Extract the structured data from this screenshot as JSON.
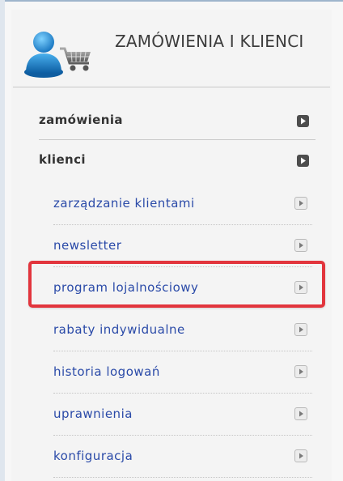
{
  "header": {
    "icon": "user-cart-icon",
    "title": "ZAMÓWIENIA I KLIENCI"
  },
  "sections": [
    {
      "label": "zamówienia",
      "icon": "square-arrow-icon"
    },
    {
      "label": "klienci",
      "icon": "square-arrow-icon"
    }
  ],
  "submenu": [
    {
      "label": "zarządzanie klientami",
      "icon": "play-arrow-icon"
    },
    {
      "label": "newsletter",
      "icon": "play-arrow-icon"
    },
    {
      "label": "program lojalnościowy",
      "icon": "play-arrow-icon"
    },
    {
      "label": "rabaty indywidualne",
      "icon": "play-arrow-icon"
    },
    {
      "label": "historia logowań",
      "icon": "play-arrow-icon"
    },
    {
      "label": "uprawnienia",
      "icon": "play-arrow-icon"
    },
    {
      "label": "konfiguracja",
      "icon": "play-arrow-icon"
    }
  ],
  "colors": {
    "link": "#2a4aa8",
    "highlight": "#e2353d",
    "section_button": "#4d4d4d"
  }
}
